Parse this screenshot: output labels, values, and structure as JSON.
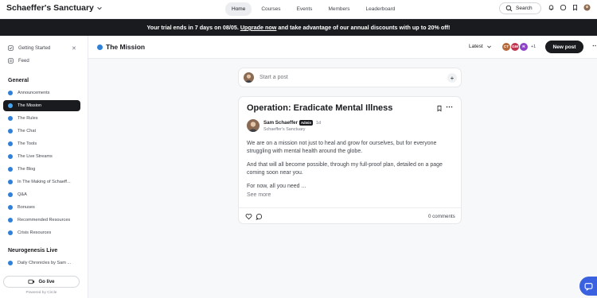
{
  "header": {
    "brand": "Schaeffer's Sanctuary",
    "nav": [
      "Home",
      "Courses",
      "Events",
      "Members",
      "Leaderboard"
    ],
    "search_label": "Search"
  },
  "banner": {
    "prefix": "Your trial ends in 7 days on 08/05.",
    "link": "Upgrade now",
    "suffix": "and take advantage of our annual discounts with up to 20% off!"
  },
  "sidebar": {
    "top_links": [
      "Getting Started",
      "Feed"
    ],
    "section_general": "General",
    "items": [
      "Announcements",
      "The Mission",
      "The Rules",
      "The Chat",
      "The Tools",
      "The Live Streams",
      "The Blog",
      "In The Making of Schaeff...",
      "Q&A",
      "Bonuses",
      "Recommended Resources",
      "Crisis Resources"
    ],
    "section_neuro": "Neurogenesis Live",
    "neuro_items": [
      "Daily Chronicles by Sam ..."
    ],
    "go_live": "Go live",
    "powered_by": "Powered by Circle"
  },
  "main": {
    "title": "The Mission",
    "sort": "Latest",
    "avatars": [
      {
        "initials": "CT",
        "color": "#b46a3c"
      },
      {
        "initials": "GM",
        "color": "#c0334f"
      },
      {
        "initials": "R",
        "color": "#8e44c8"
      }
    ],
    "extra_members": "+1",
    "new_post": "New post"
  },
  "composer": {
    "placeholder": "Start a post"
  },
  "post": {
    "title": "Operation: Eradicate Mental Illness",
    "author": "Sam Schaeffer",
    "badge": "Admin",
    "ago": "1d",
    "community": "Schaeffer's Sanctuary",
    "paragraphs": [
      "We are on a mission not just to heal and grow for ourselves, but for everyone",
      "struggling with mental health around the globe.",
      "And that will all become possible, through my full-proof plan, detailed on a page",
      "coming soon near you.",
      "For now, all you need ..."
    ],
    "see_more": "See more",
    "comments": "0 comments"
  },
  "colors": {
    "accent": "#2f80d8",
    "dark": "#191b1f",
    "chat": "#3a62e0"
  }
}
